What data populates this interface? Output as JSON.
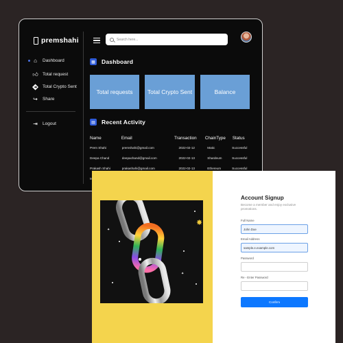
{
  "dashboard": {
    "brand": "premshahi",
    "nav": [
      {
        "label": "Dashboard",
        "icon": "home-icon",
        "active": true
      },
      {
        "label": "Total request",
        "icon": "thumbs-up-icon"
      },
      {
        "label": "Total Crypto Sent",
        "icon": "send-icon"
      },
      {
        "label": "Share",
        "icon": "share-icon"
      },
      {
        "label": "Logout",
        "icon": "logout-icon"
      }
    ],
    "search_placeholder": "Search here...",
    "section_title": "Dashboard",
    "cards": [
      {
        "label": "Total requests"
      },
      {
        "label": "Total Crypto Sent"
      },
      {
        "label": "Balance"
      }
    ],
    "activity_title": "Recent Activity",
    "table": {
      "headers": [
        "Name",
        "Email",
        "Transaction",
        "ChainType",
        "Status"
      ],
      "rows": [
        [
          "Prem Shahi",
          "premshahi@gmail.com",
          "2022-02-12",
          "Matic",
          "Successful"
        ],
        [
          "Deepa Chand",
          "deepachand@gmail.com",
          "2022-02-13",
          "Shardeum",
          "Successful"
        ],
        [
          "Prakash Shahi",
          "prakashahi@gmail.com",
          "2022-02-13",
          "Ethereum",
          "Successful"
        ],
        [
          "Manisha Chand",
          "manishachand@gmail.com",
          "2022-02-15",
          "Matic",
          "Failed"
        ]
      ]
    },
    "accent_color": "#2f5bd8",
    "card_color": "#6a9fd6"
  },
  "signup": {
    "title": "Account Signup",
    "subtitle": "Become a member and enjoy exclusive promotions.",
    "fields": [
      {
        "label": "Full Name",
        "value": "John Doe"
      },
      {
        "label": "Email Address",
        "value": "sample.e.example.com"
      },
      {
        "label": "Password",
        "value": ""
      },
      {
        "label": "Re - Enter Password",
        "value": ""
      }
    ],
    "submit_label": "Confirm",
    "accent_color": "#0d78ff",
    "panel_color": "#f4d44d"
  }
}
